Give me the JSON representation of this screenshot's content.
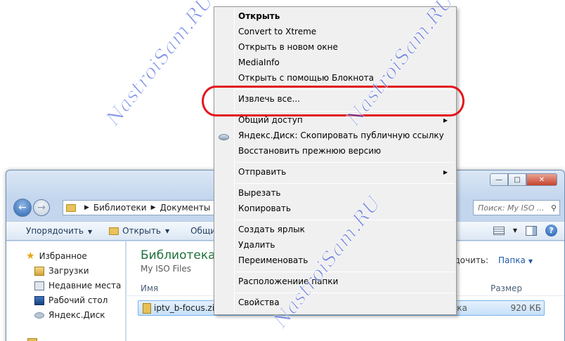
{
  "explorer": {
    "address": [
      "Библиотеки",
      "Документы"
    ],
    "search_placeholder": "Поиск: My ISO ...",
    "toolbar": {
      "organize": "Упорядочить",
      "open": "Открыть",
      "share": "Общи"
    },
    "nav": {
      "favorites": "Избранное",
      "items": [
        "Загрузки",
        "Недавние места",
        "Рабочий стол",
        "Яндекс.Диск"
      ]
    },
    "library_title": "Библиотека",
    "library_subtitle": "My ISO Files",
    "arrange_label": "дочить:",
    "arrange_value": "Папка",
    "columns": {
      "name": "Имя",
      "size": "Размер"
    },
    "file": {
      "name": "iptv_b-focus.zip",
      "type": "апка",
      "size": "920 КБ"
    }
  },
  "context_menu": {
    "items": [
      {
        "label": "Открыть",
        "bold": true
      },
      {
        "label": "Convert to Xtreme"
      },
      {
        "label": "Открыть в новом окне"
      },
      {
        "label": "MediaInfo"
      },
      {
        "label": "Открыть с помощью Блокнота"
      },
      {
        "label": "Извлечь все..."
      },
      {
        "label": "Общий доступ",
        "submenu": true
      },
      {
        "label": "Яндекс.Диск: Скопировать публичную ссылку"
      },
      {
        "label": "Восстановить прежнюю версию"
      },
      {
        "label": "Отправить",
        "submenu": true
      },
      {
        "label": "Вырезать"
      },
      {
        "label": "Копировать"
      },
      {
        "label": "Создать ярлык"
      },
      {
        "label": "Удалить"
      },
      {
        "label": "Переименовать"
      },
      {
        "label": "Расположениие папки"
      },
      {
        "label": "Свойства"
      }
    ]
  },
  "watermark": "NastroiSam.RU",
  "colors": {
    "highlight": "#e3161c",
    "watermark": "#1b3cd8"
  }
}
